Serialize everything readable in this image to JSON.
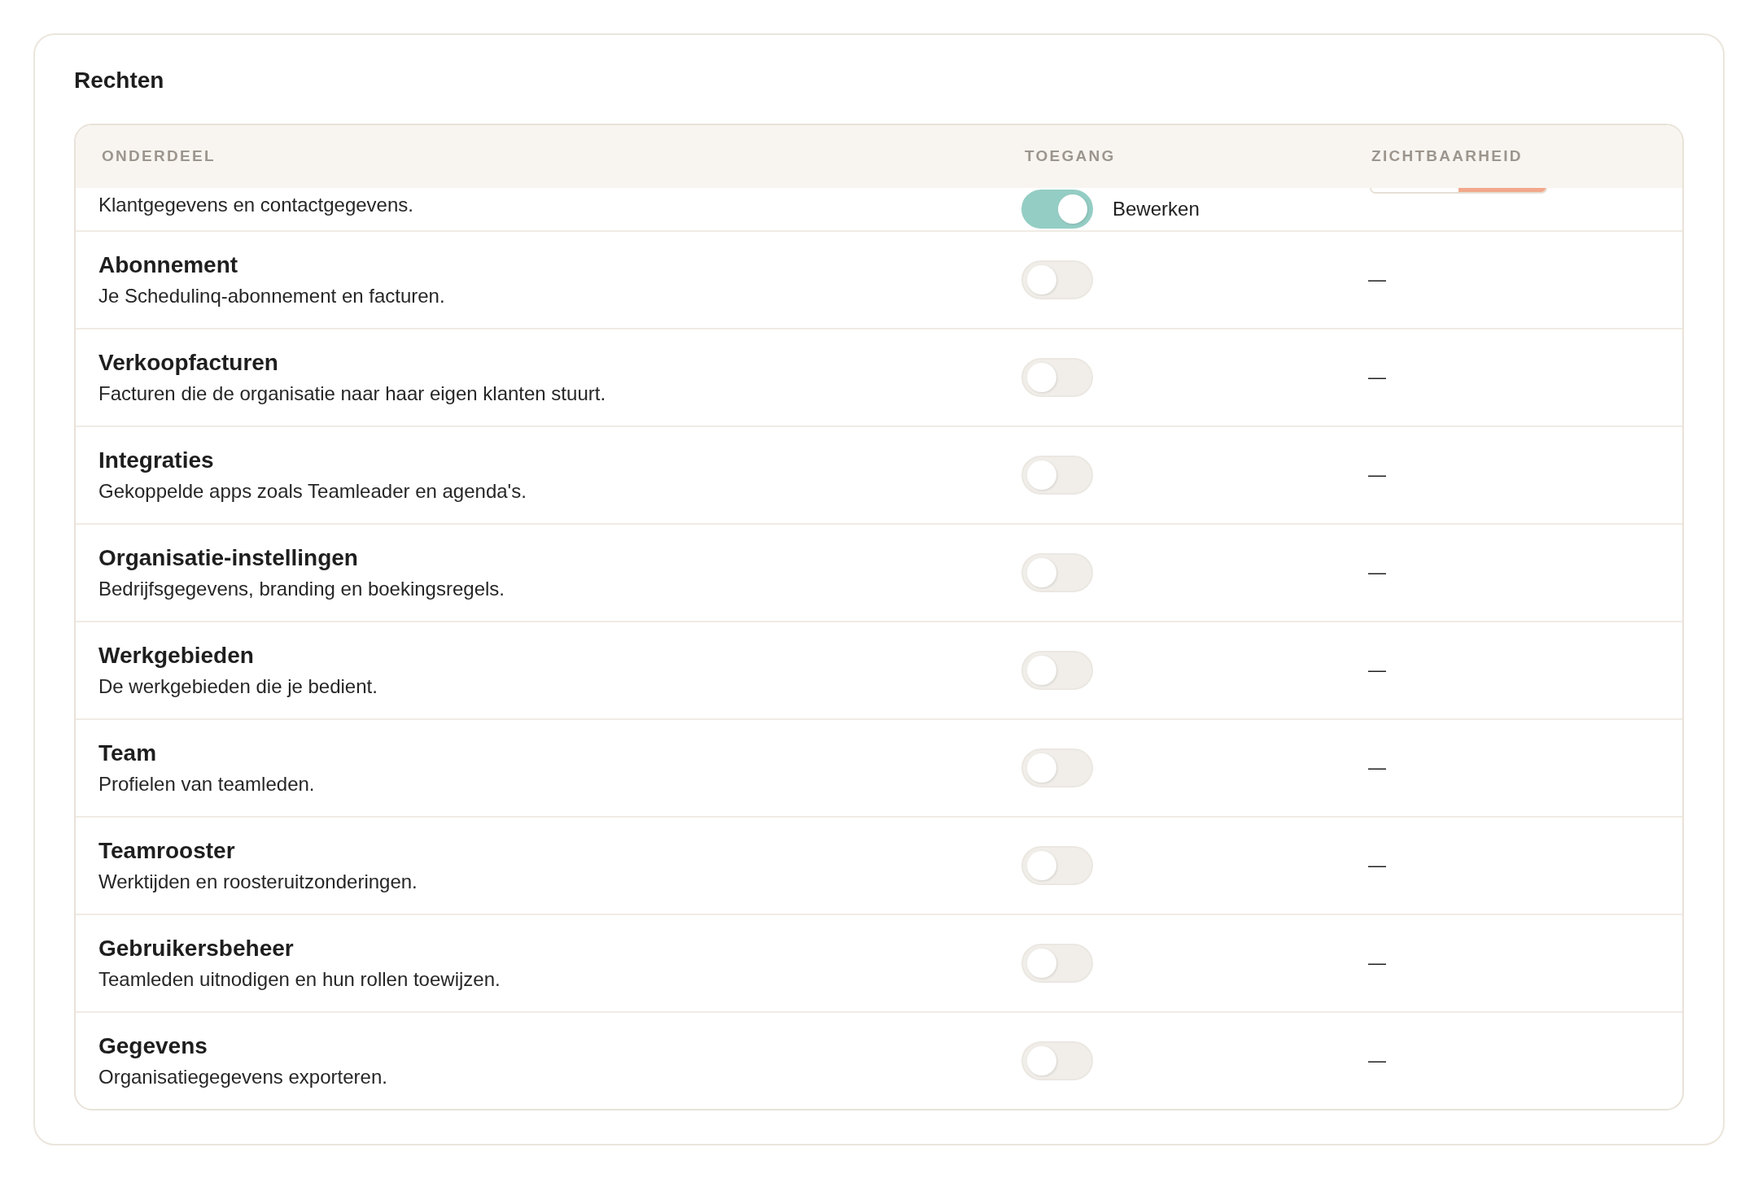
{
  "card": {
    "title": "Rechten"
  },
  "table": {
    "columns": [
      "ONDERDEEL",
      "TOEGANG",
      "ZICHTBAARHEID"
    ],
    "rows": [
      {
        "kind": "partial",
        "description": "Klantgegevens en contactgegevens.",
        "access": {
          "on": true,
          "label": "Bewerken"
        },
        "visibility_segments": [
          {
            "selected": false
          },
          {
            "selected": true
          }
        ]
      },
      {
        "kind": "full",
        "title": "Abonnement",
        "description": "Je Schedulinq-abonnement en facturen.",
        "access": {
          "on": false
        },
        "visibility": "—"
      },
      {
        "kind": "full",
        "title": "Verkoopfacturen",
        "description": "Facturen die de organisatie naar haar eigen klanten stuurt.",
        "access": {
          "on": false
        },
        "visibility": "—"
      },
      {
        "kind": "full",
        "title": "Integraties",
        "description": "Gekoppelde apps zoals Teamleader en agenda's.",
        "access": {
          "on": false
        },
        "visibility": "—"
      },
      {
        "kind": "full",
        "title": "Organisatie-instellingen",
        "description": "Bedrijfsgegevens, branding en boekingsregels.",
        "access": {
          "on": false
        },
        "visibility": "—"
      },
      {
        "kind": "full",
        "title": "Werkgebieden",
        "description": "De werkgebieden die je bedient.",
        "access": {
          "on": false
        },
        "visibility": "—"
      },
      {
        "kind": "full",
        "title": "Team",
        "description": "Profielen van teamleden.",
        "access": {
          "on": false
        },
        "visibility": "—"
      },
      {
        "kind": "full",
        "title": "Teamrooster",
        "description": "Werktijden en roosteruitzonderingen.",
        "access": {
          "on": false
        },
        "visibility": "—"
      },
      {
        "kind": "full",
        "title": "Gebruikersbeheer",
        "description": "Teamleden uitnodigen en hun rollen toewijzen.",
        "access": {
          "on": false
        },
        "visibility": "—"
      },
      {
        "kind": "full",
        "title": "Gegevens",
        "description": "Organisatiegegevens exporteren.",
        "access": {
          "on": false
        },
        "visibility": "—"
      }
    ]
  }
}
